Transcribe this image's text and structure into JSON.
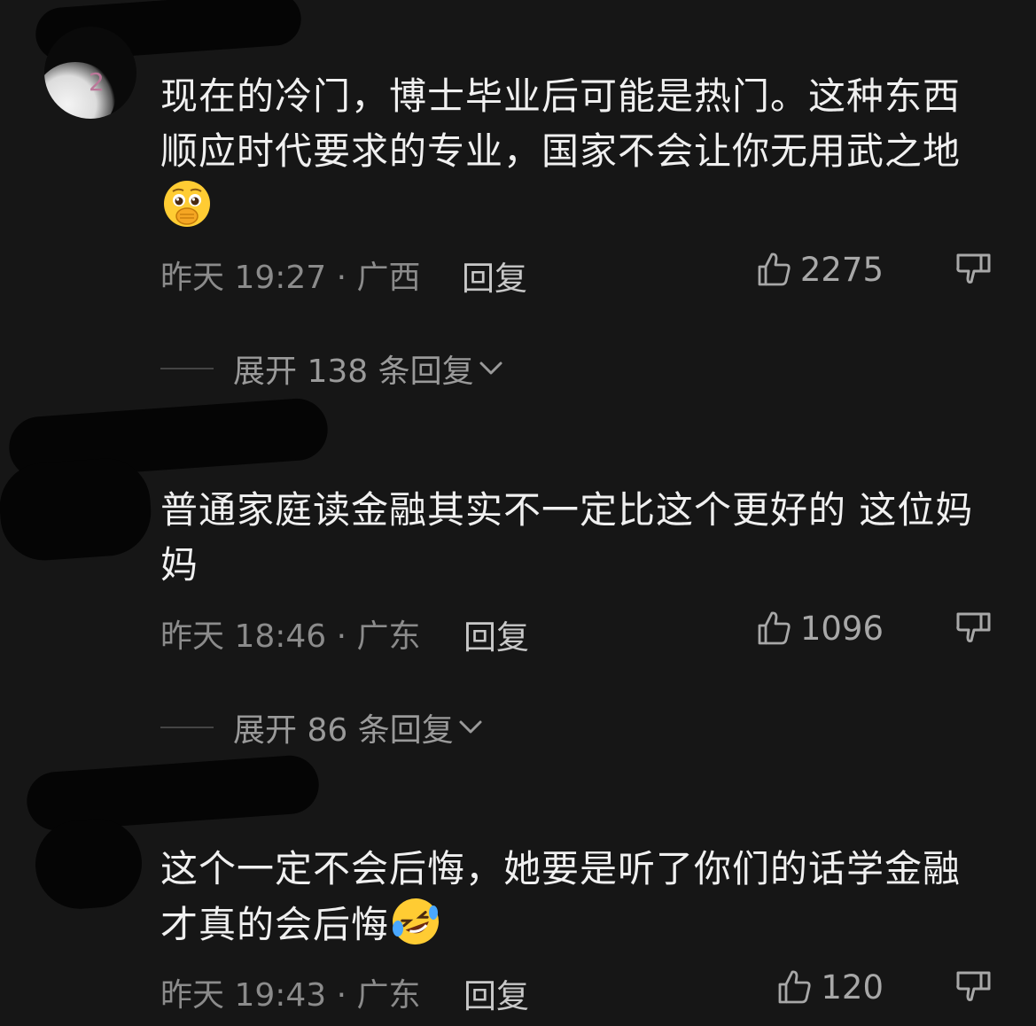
{
  "colors": {
    "background": "#161616",
    "text_primary": "#f0f0f0",
    "text_meta": "#8b8b8b",
    "reply_text": "#c8c8c8"
  },
  "comments": [
    {
      "text": "现在的冷门，博士毕业后可能是热门。这种东西顺应时代要求的专业，国家不会让你无用武之地",
      "emoji": "pleading-face-hand-over-mouth",
      "meta": "昨天 19:27 · 广西",
      "reply_label": "回复",
      "like_count": "2275",
      "expand_label": "展开 138 条回复"
    },
    {
      "text": "普通家庭读金融其实不一定比这个更好的 这位妈妈",
      "meta": "昨天 18:46 · 广东",
      "reply_label": "回复",
      "like_count": "1096",
      "expand_label": "展开 86 条回复"
    },
    {
      "text": "这个一定不会后悔，她要是听了你们的话学金融才真的会后悔",
      "emoji": "rolling-on-floor-laughing",
      "meta": "昨天 19:43 · 广东",
      "reply_label": "回复",
      "like_count": "120"
    }
  ]
}
